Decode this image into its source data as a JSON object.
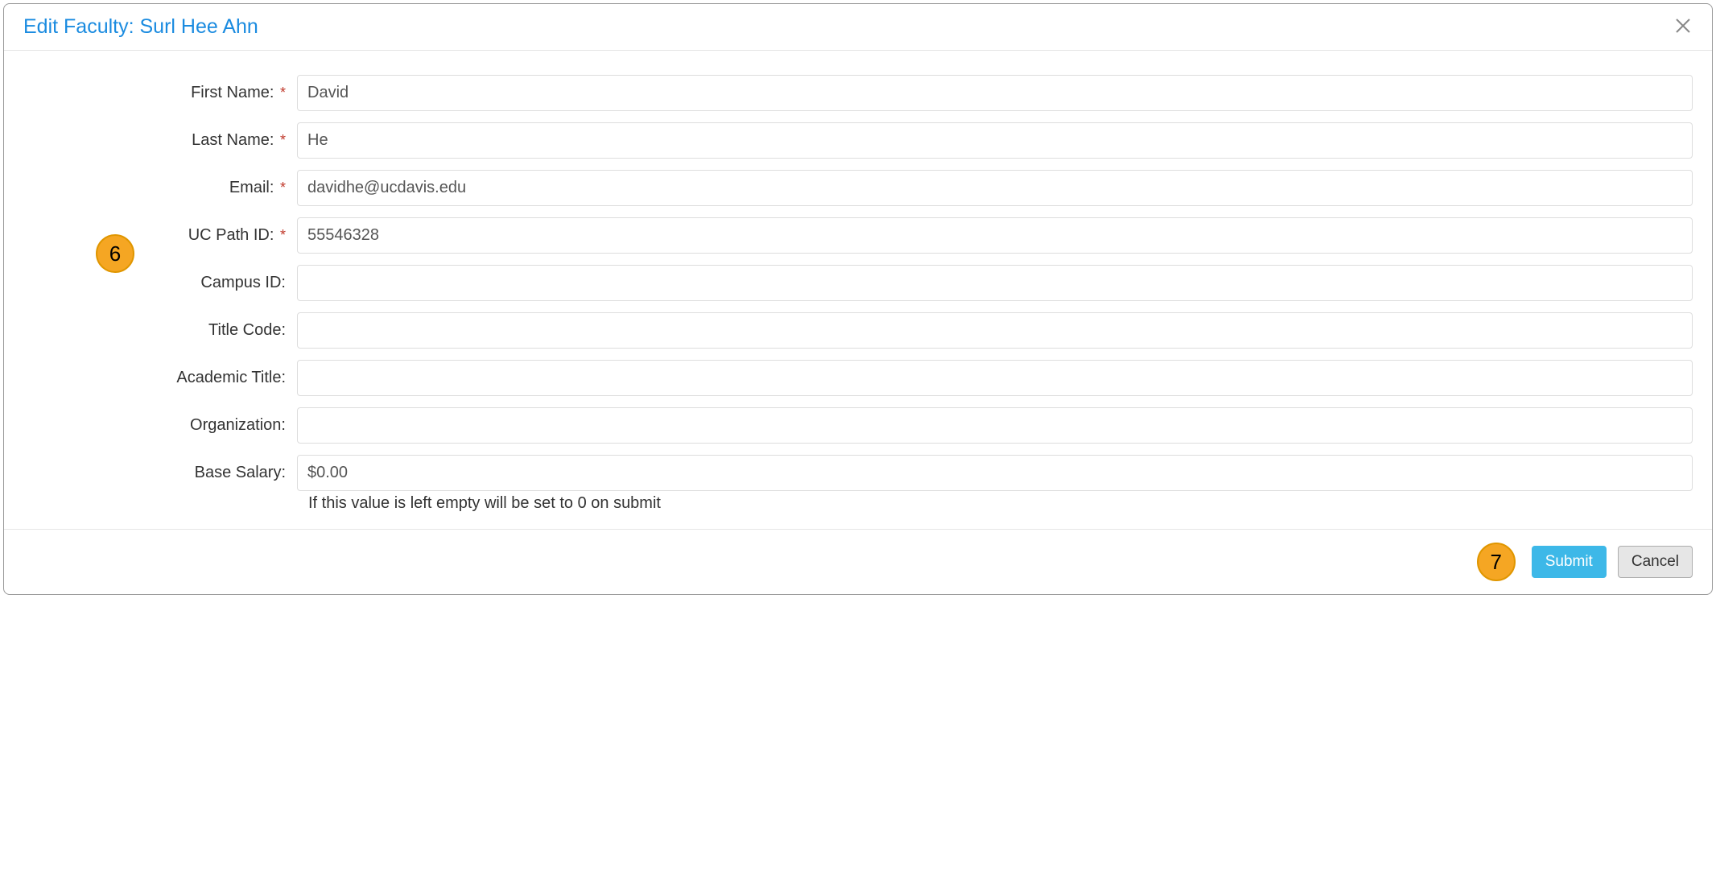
{
  "dialog": {
    "title": "Edit Faculty: Surl Hee Ahn"
  },
  "form": {
    "first_name": {
      "label": "First Name:",
      "value": "David",
      "required": true
    },
    "last_name": {
      "label": "Last Name:",
      "value": "He",
      "required": true
    },
    "email": {
      "label": "Email:",
      "value": "davidhe@ucdavis.edu",
      "required": true
    },
    "uc_path_id": {
      "label": "UC Path ID:",
      "value": "55546328",
      "required": true
    },
    "campus_id": {
      "label": "Campus ID:",
      "value": "",
      "required": false
    },
    "title_code": {
      "label": "Title Code:",
      "value": "",
      "required": false
    },
    "academic_title": {
      "label": "Academic Title:",
      "value": "",
      "required": false
    },
    "organization": {
      "label": "Organization:",
      "value": "",
      "required": false
    },
    "base_salary": {
      "label": "Base Salary:",
      "value": "$0.00",
      "required": false,
      "help": "If this value is left empty will be set to 0 on submit"
    }
  },
  "footer": {
    "submit_label": "Submit",
    "cancel_label": "Cancel"
  },
  "callouts": {
    "six": "6",
    "seven": "7"
  },
  "required_marker": "*"
}
